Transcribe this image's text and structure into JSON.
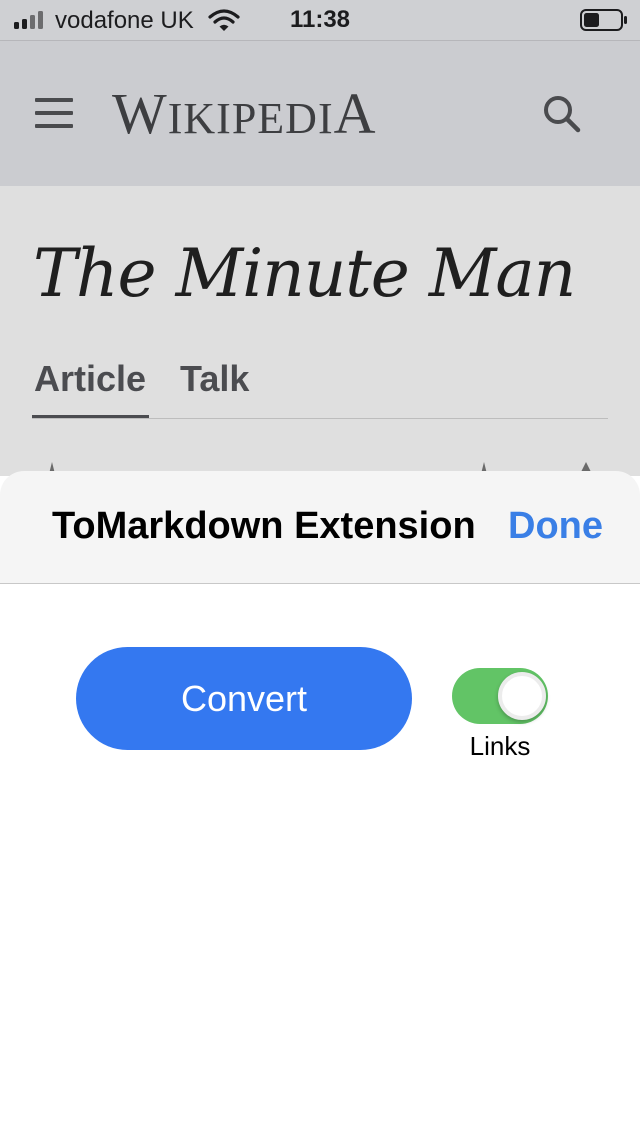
{
  "status_bar": {
    "carrier": "vodafone UK",
    "time": "11:38",
    "signal_bars_active": 2,
    "battery_level": 0.45
  },
  "wiki_header": {
    "wordmark": {
      "w": "W",
      "ikipedi": "IKIPEDI",
      "a": "A"
    },
    "menu_icon": "hamburger-icon",
    "search_icon": "search-icon"
  },
  "article": {
    "title": "The Minute Man",
    "tabs": [
      {
        "label": "Article",
        "selected": true
      },
      {
        "label": "Talk",
        "selected": false
      }
    ]
  },
  "sheet": {
    "title": "ToMarkdown Extension",
    "done_label": "Done",
    "convert_label": "Convert",
    "links_toggle": {
      "label": "Links",
      "on": true
    }
  },
  "colors": {
    "accent_blue": "#3478f0",
    "done_blue": "#3a7fe6",
    "toggle_green": "#62c466"
  }
}
